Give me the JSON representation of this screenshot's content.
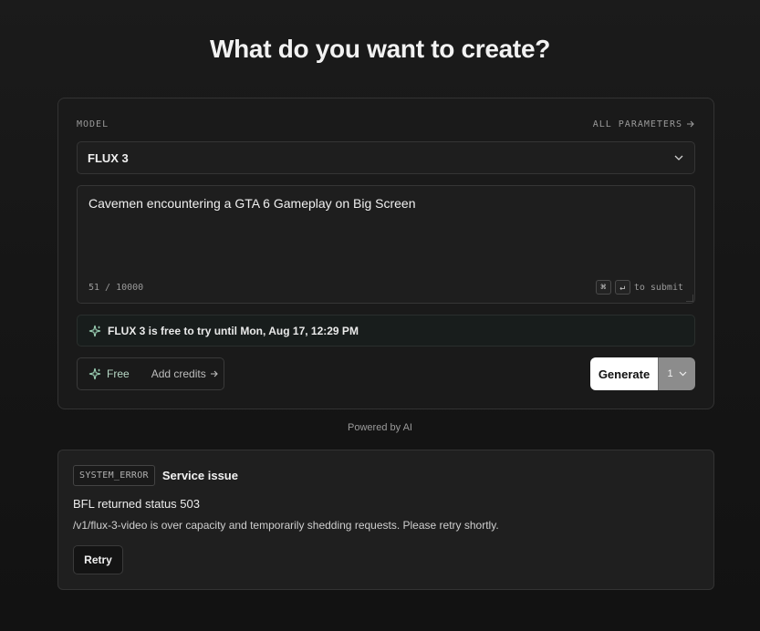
{
  "page": {
    "title": "What do you want to create?",
    "powered_by": "Powered by AI"
  },
  "form": {
    "model_label": "MODEL",
    "all_parameters": "ALL PARAMETERS",
    "model_value": "FLUX 3",
    "prompt": "Cavemen encountering a GTA 6 Gameplay on Big Screen",
    "char_count": "51 / 10000",
    "submit_hint": "to submit",
    "kbd_cmd": "⌘",
    "kbd_enter": "↵",
    "info_banner": "FLUX 3 is free to try until Mon, Aug 17, 12:29 PM",
    "plan_label": "Free",
    "add_credits": "Add credits",
    "generate_label": "Generate",
    "count_value": "1"
  },
  "error": {
    "code": "SYSTEM_ERROR",
    "title": "Service issue",
    "status": "BFL returned status 503",
    "detail": "/v1/flux-3-video is over capacity and temporarily shedding requests. Please retry shortly.",
    "retry_label": "Retry"
  },
  "colors": {
    "accent_mint": "#9fd4b8",
    "background": "#141414",
    "card": "#1a1a1a"
  },
  "icons": [
    "arrow-right-icon",
    "chevron-down-icon",
    "sparkle-icon"
  ]
}
